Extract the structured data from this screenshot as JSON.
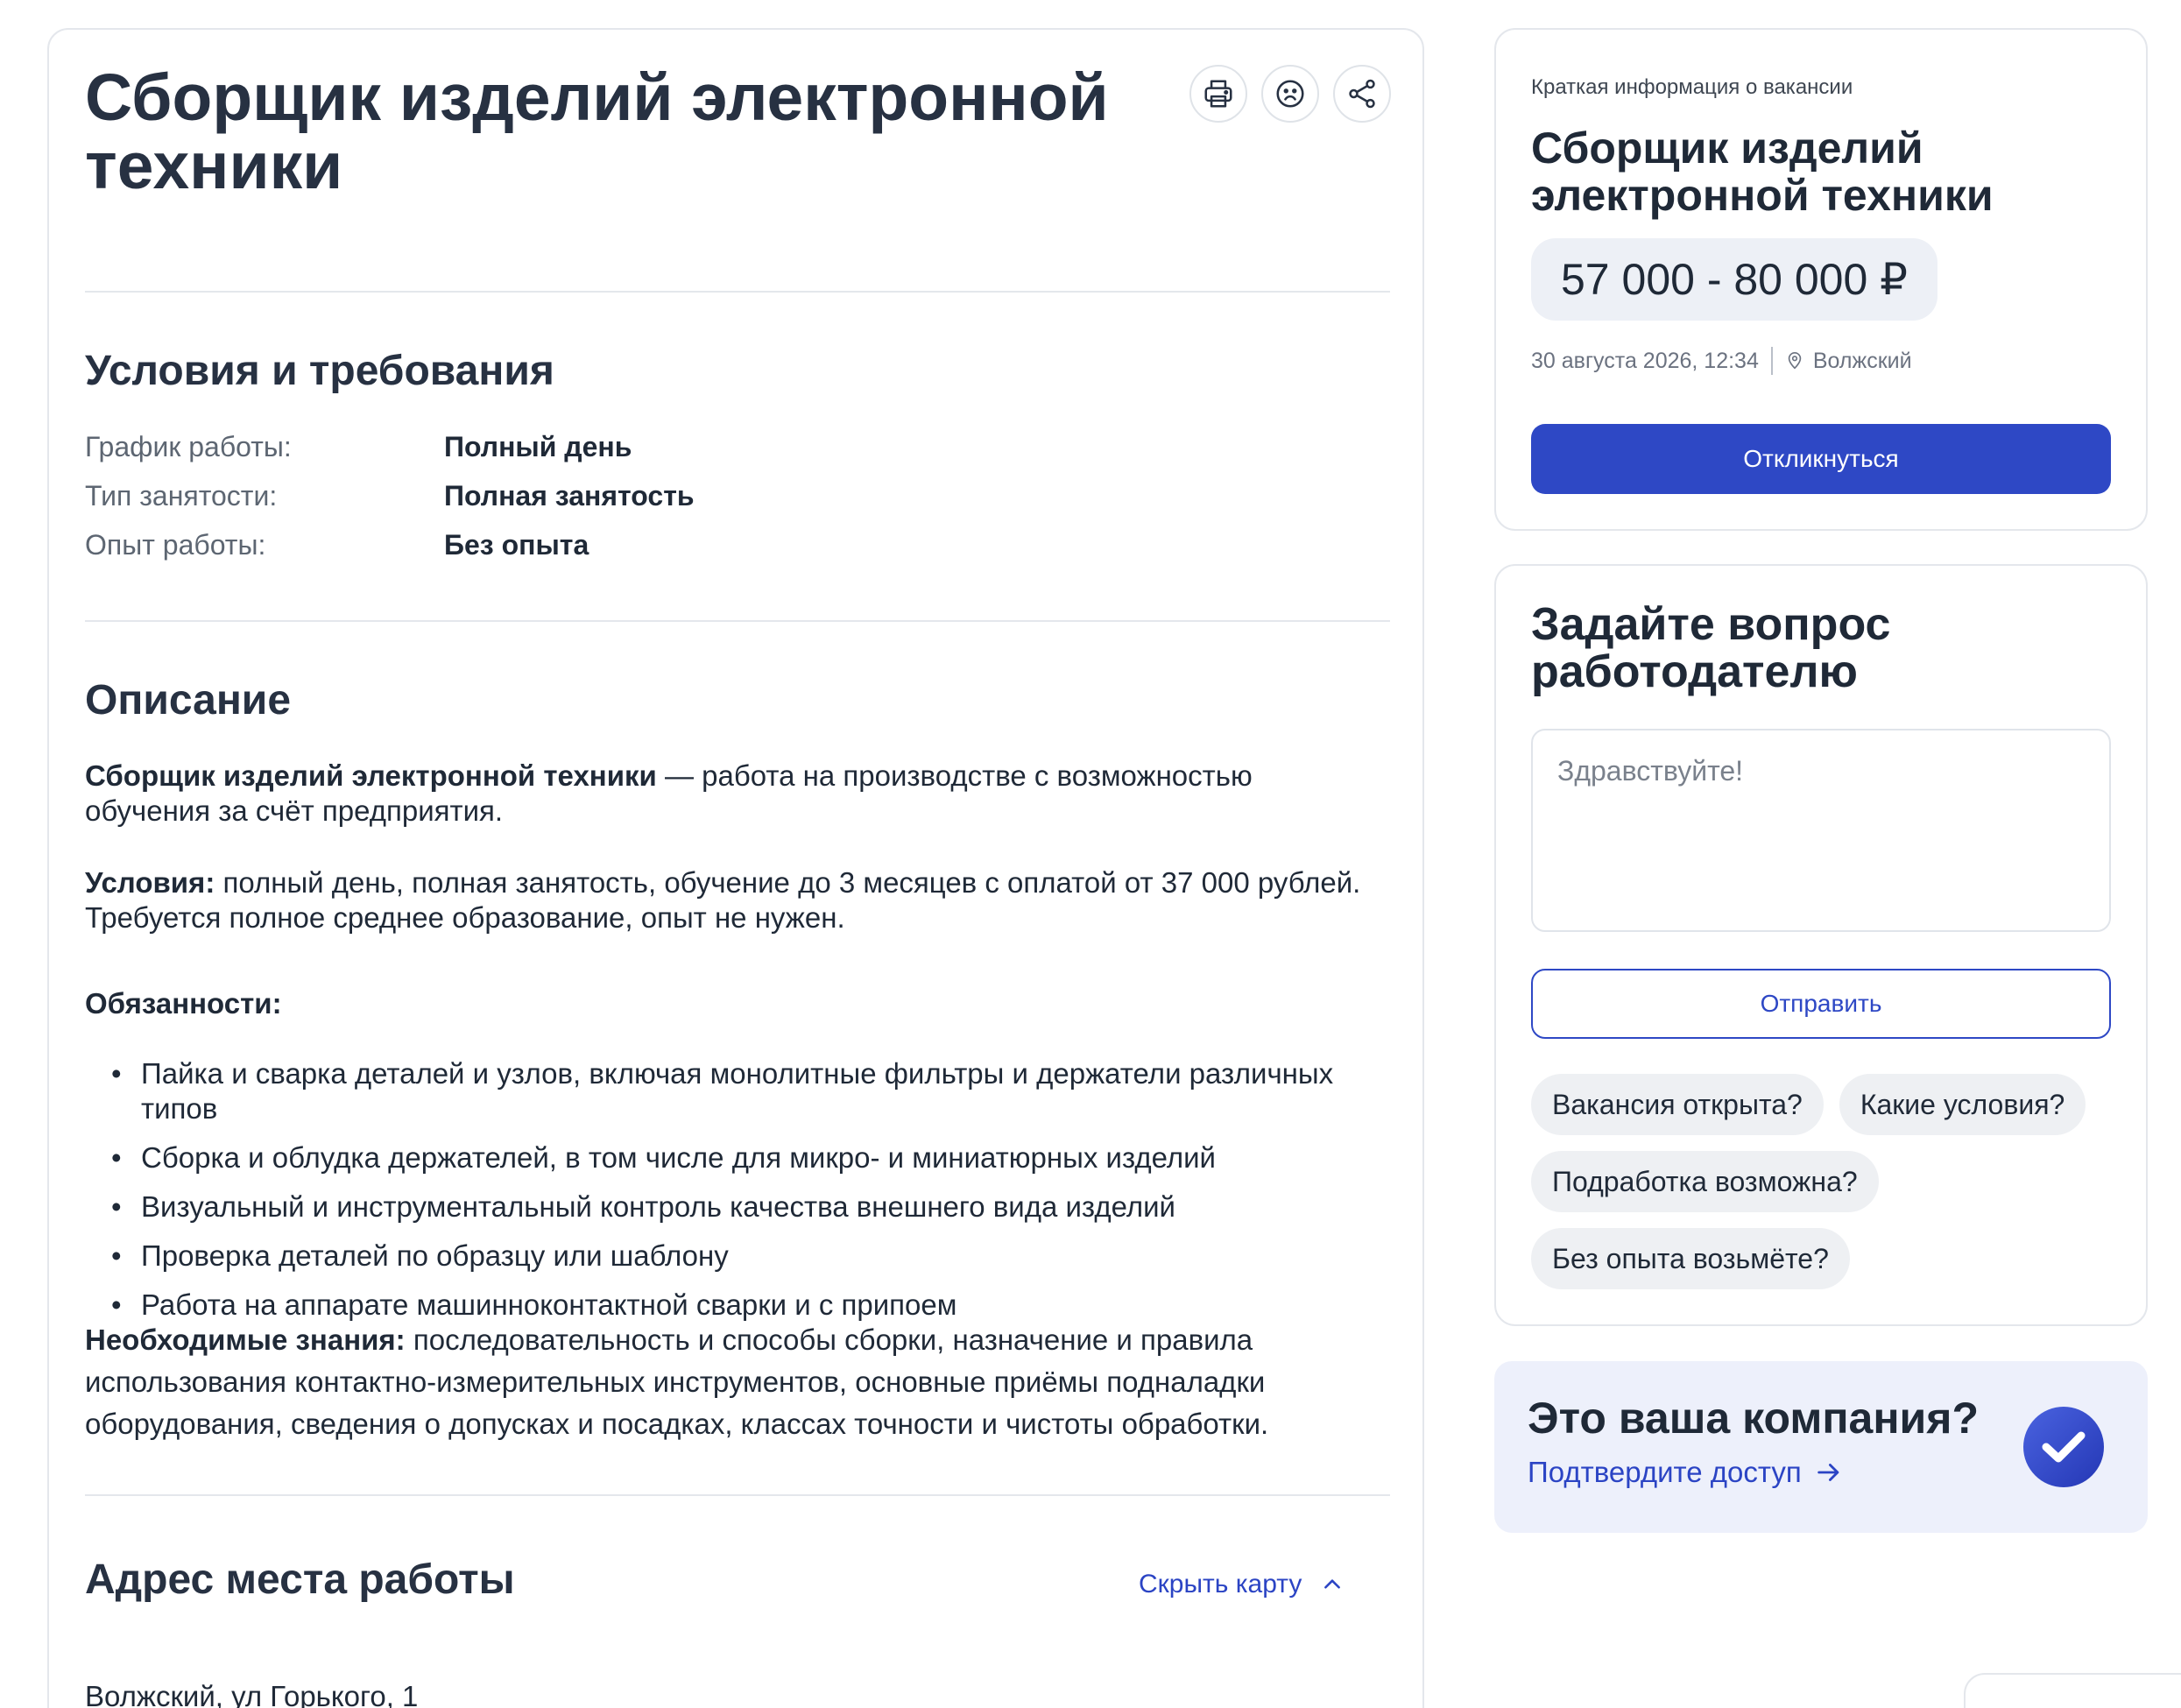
{
  "job": {
    "title": "Сборщик изделий электронной техники",
    "actions": [
      "printer-icon",
      "sad-face-icon",
      "share-icon"
    ]
  },
  "conditions": {
    "heading": "Условия и требования",
    "rows": [
      {
        "label": "График работы:",
        "value": "Полный день"
      },
      {
        "label": "Тип занятости:",
        "value": "Полная занятость"
      },
      {
        "label": "Опыт работы:",
        "value": "Без опыта"
      }
    ]
  },
  "description": {
    "heading": "Описание",
    "intro_bold": "Сборщик изделий электронной техники",
    "intro_text": " — работа на производстве с возможностью обучения за счёт предприятия.",
    "conditions_bold": "Условия:",
    "conditions_text": " полный день, полная занятость, обучение до 3 месяцев с оплатой от 37 000 рублей. Требуется полное среднее образование, опыт не нужен.",
    "duties_heading": "Обязанности:",
    "duties": [
      "Пайка и сварка деталей и узлов, включая монолитные фильтры и держатели различных типов",
      "Сборка и облудка держателей, в том числе для микро- и миниатюрных изделий",
      "Визуальный и инструментальный контроль качества внешнего вида изделий",
      "Проверка деталей по образцу или шаблону",
      "Работа на аппарате машинноконтактной сварки и с припоем"
    ],
    "knowledge_bold": "Необходимые знания:",
    "knowledge_text": " последовательность и способы сборки, назначение и правила использования контактно-измерительных инструментов, основные приёмы подналадки оборудования, сведения о допусках и посадках, классах точности и чистоты обработки."
  },
  "address": {
    "heading": "Адрес места работы",
    "toggle_label": "Скрыть карту",
    "value": "Волжский, ул Горького, 1"
  },
  "summary": {
    "caption": "Краткая информация о вакансии",
    "title": "Сборщик изделий электронной техники",
    "salary": "57 000 - 80 000 ₽",
    "date": "30 августа 2026, 12:34",
    "city": "Волжский",
    "apply_label": "Откликнуться"
  },
  "question": {
    "heading": "Задайте вопрос работодателю",
    "placeholder": "Здравствуйте!",
    "send_label": "Отправить",
    "chips": [
      "Вакансия открыта?",
      "Какие условия?",
      "Подработка возможна?",
      "Без опыта возьмёте?"
    ]
  },
  "company": {
    "title": "Это ваша компания?",
    "link_label": "Подтвердите доступ"
  },
  "colors": {
    "accent": "#2e48c5",
    "link": "#2b44c4",
    "company_bg": "#edf0fb"
  }
}
